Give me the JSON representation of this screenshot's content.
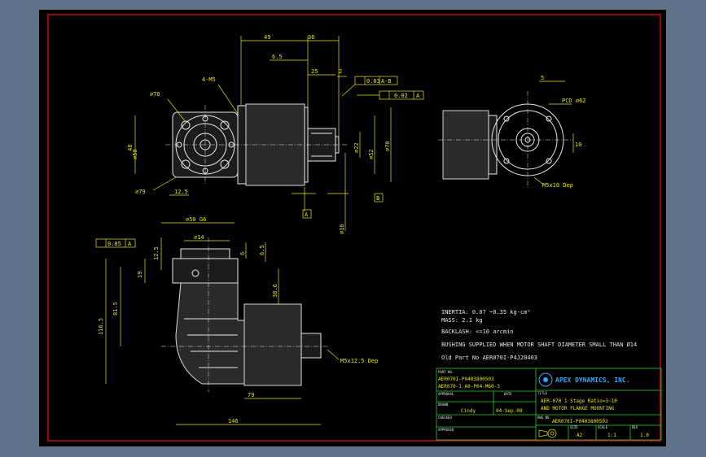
{
  "dims": {
    "d49": "49",
    "d36": "36",
    "d65": "6.5",
    "d25": "25",
    "d2": "2",
    "d4m5": "4-M5",
    "d70g": "⌀70",
    "d48": "48",
    "d50": "⌀50",
    "d79": "⌀79",
    "d125": "12.5",
    "d22": "⌀22",
    "d52": "⌀52",
    "d70": "⌀70",
    "d16": "⌀16",
    "d5": "5",
    "pcd": "PCD ⌀62",
    "d10": "10",
    "m5x10": "M5x10 Dep",
    "d50b": "⌀50 G6",
    "d14": "⌀14",
    "d125b": "12.5",
    "d19": "19",
    "d6": "6",
    "d65b": "6.5",
    "d815": "81.5",
    "d1165": "116.5",
    "d386": "38.6",
    "d79b": "79",
    "d146": "146",
    "m5x125": "M5x12.5 Dep"
  },
  "tolerances": {
    "t1": "0.03",
    "t1ref": "A-B",
    "t2": "0.02",
    "t2ref": "A",
    "t3": "0.05",
    "t3ref": "A"
  },
  "datums": {
    "a": "A",
    "b": "B"
  },
  "notes": {
    "inertia": "INERTIA:   0.07 ~0.35  kg-cm²",
    "mass": "MASS: 2.1  kg",
    "backlash": "BACKLASH: <=10 arcmin",
    "bushing": "BUSHING SUPPLIED WHEN MOTOR SHAFT DIAMETER SMALL THAN Ø14",
    "oldpart": "Old Part No  AER070I-P4J20403"
  },
  "title_block": {
    "part_no_label": "PART NO.",
    "part_no_1": "AER070I-P0403800503",
    "part_no_2": "AER070-1  A0-P64-M60-3",
    "logo": "APEX DYNAMICS, INC.",
    "title_label": "TITLE",
    "title_1": "AER-070 1 Stage  Ratio=3~10",
    "title_2": "AND MOTOR FLANGE MOUNTING",
    "approval_label": "APPROVAL",
    "date_label": "DATE",
    "drawn_label": "DRAWN",
    "drawn_by": "Cindy",
    "drawn_date": "04-Sep-08",
    "checked_label": "CHECKED",
    "dwg_no_label": "DWG NO.",
    "dwg_no": "AER070I-P0403800503",
    "approved_label": "APPROVED",
    "size_label": "SIZE",
    "size": "A2",
    "scale_label": "SCALE",
    "scale": "1:1",
    "rev_label": "REV",
    "rev": "1.0"
  }
}
